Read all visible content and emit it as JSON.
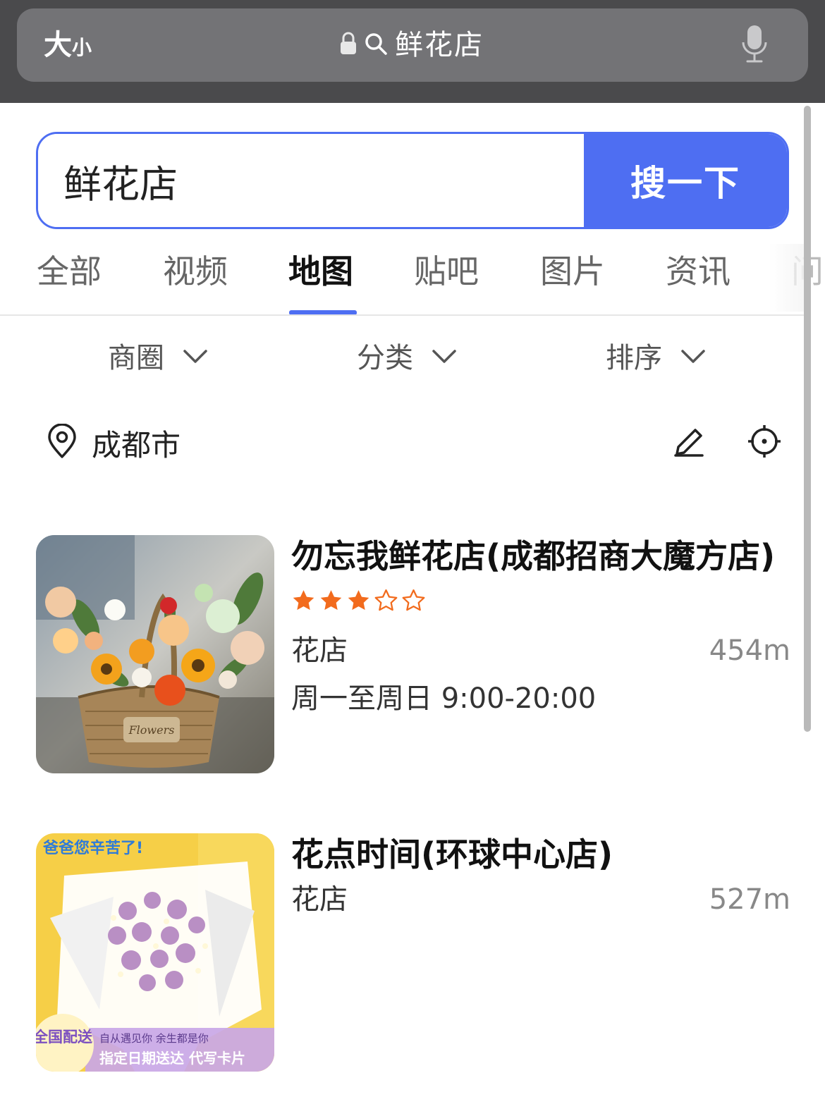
{
  "browser": {
    "text_size_label_big": "大",
    "text_size_label_small": "小",
    "url_text": "鲜花店"
  },
  "search": {
    "query": "鲜花店",
    "button_label": "搜一下"
  },
  "tabs": [
    {
      "label": "全部",
      "active": false
    },
    {
      "label": "视频",
      "active": false
    },
    {
      "label": "地图",
      "active": true
    },
    {
      "label": "贴吧",
      "active": false
    },
    {
      "label": "图片",
      "active": false
    },
    {
      "label": "资讯",
      "active": false
    },
    {
      "label": "问",
      "active": false
    }
  ],
  "filters": [
    {
      "label": "商圈"
    },
    {
      "label": "分类"
    },
    {
      "label": "排序"
    }
  ],
  "location": {
    "city": "成都市"
  },
  "results": [
    {
      "title": "勿忘我鲜花店(成都招商大魔方店)",
      "rating": 3,
      "rating_max": 5,
      "category": "花店",
      "distance": "454m",
      "hours": "周一至周日 9:00-20:00",
      "photo_overlay_text": "Flowers"
    },
    {
      "title": "花点时间(环球中心店)",
      "category": "花店",
      "distance": "527m",
      "photo_sticker": "爸爸您辛苦了!",
      "photo_badge": "全国配送",
      "photo_banner_line1": "自从遇见你 余生都是你",
      "photo_banner_line2": "指定日期送达 代写卡片"
    }
  ],
  "colors": {
    "accent": "#4e6ef2",
    "star": "#f26b1d",
    "topbar": "#4a4a4c"
  }
}
